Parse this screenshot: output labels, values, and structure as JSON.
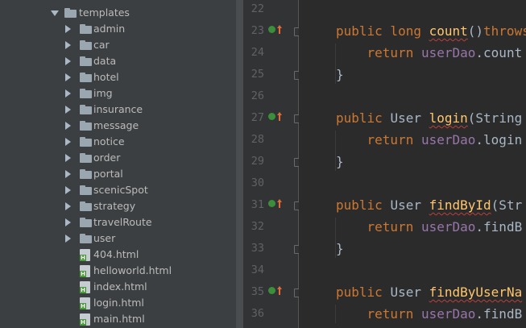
{
  "project_tree": {
    "parent": "templates",
    "folders": [
      "admin",
      "car",
      "data",
      "hotel",
      "img",
      "insurance",
      "message",
      "notice",
      "order",
      "portal",
      "scenicSpot",
      "strategy",
      "travelRoute",
      "user"
    ],
    "files": [
      "404.html",
      "helloworld.html",
      "index.html",
      "login.html",
      "main.html"
    ]
  },
  "editor": {
    "lines": [
      {
        "n": "22"
      },
      {
        "n": "23",
        "code": [
          {
            "t": "public long ",
            "c": "kw"
          },
          {
            "t": "count",
            "c": "fn"
          },
          {
            "t": "()",
            "c": "plain"
          },
          {
            "t": "throws",
            "c": "kw"
          }
        ]
      },
      {
        "n": "24",
        "code": [
          {
            "t": "    return ",
            "c": "kw"
          },
          {
            "t": "userDao",
            "c": "fld"
          },
          {
            "t": ".count",
            "c": "plain"
          }
        ]
      },
      {
        "n": "25",
        "code": [
          {
            "t": "}",
            "c": "brace"
          }
        ]
      },
      {
        "n": "26"
      },
      {
        "n": "27",
        "code": [
          {
            "t": "public ",
            "c": "kw"
          },
          {
            "t": "User ",
            "c": "plain"
          },
          {
            "t": "login",
            "c": "fn"
          },
          {
            "t": "(String",
            "c": "plain"
          }
        ]
      },
      {
        "n": "28",
        "code": [
          {
            "t": "    return ",
            "c": "kw"
          },
          {
            "t": "userDao",
            "c": "fld"
          },
          {
            "t": ".login",
            "c": "plain"
          }
        ]
      },
      {
        "n": "29",
        "code": [
          {
            "t": "}",
            "c": "brace"
          }
        ]
      },
      {
        "n": "30"
      },
      {
        "n": "31",
        "code": [
          {
            "t": "public ",
            "c": "kw"
          },
          {
            "t": "User ",
            "c": "plain"
          },
          {
            "t": "findById",
            "c": "fn"
          },
          {
            "t": "(Str",
            "c": "plain"
          }
        ]
      },
      {
        "n": "32",
        "code": [
          {
            "t": "    return ",
            "c": "kw"
          },
          {
            "t": "userDao",
            "c": "fld"
          },
          {
            "t": ".findB",
            "c": "plain"
          }
        ]
      },
      {
        "n": "33",
        "code": [
          {
            "t": "}",
            "c": "brace"
          }
        ]
      },
      {
        "n": "34"
      },
      {
        "n": "35",
        "code": [
          {
            "t": "public ",
            "c": "kw"
          },
          {
            "t": "User ",
            "c": "plain"
          },
          {
            "t": "findByUserNa",
            "c": "fn"
          }
        ]
      },
      {
        "n": "36",
        "code": [
          {
            "t": "    return ",
            "c": "kw"
          },
          {
            "t": "userDao",
            "c": "fld"
          },
          {
            "t": ".findB",
            "c": "plain"
          }
        ]
      }
    ],
    "override_marker_lines": [
      "23",
      "27",
      "31",
      "35"
    ],
    "fold_marker_lines": [
      "23",
      "25",
      "27",
      "29",
      "31",
      "33",
      "35"
    ]
  },
  "colors": {
    "keyword": "#cc7832",
    "method": "#ffc66d",
    "field": "#9876aa",
    "text": "#a9b7c6",
    "line_number": "#606366",
    "tree_bg": "#3c3f41",
    "editor_bg": "#2b2b2b"
  },
  "icons": {
    "folder": "folder-icon",
    "html_file": "html-file-icon",
    "override": "override-gutter-icon",
    "fold": "fold-marker-icon"
  }
}
